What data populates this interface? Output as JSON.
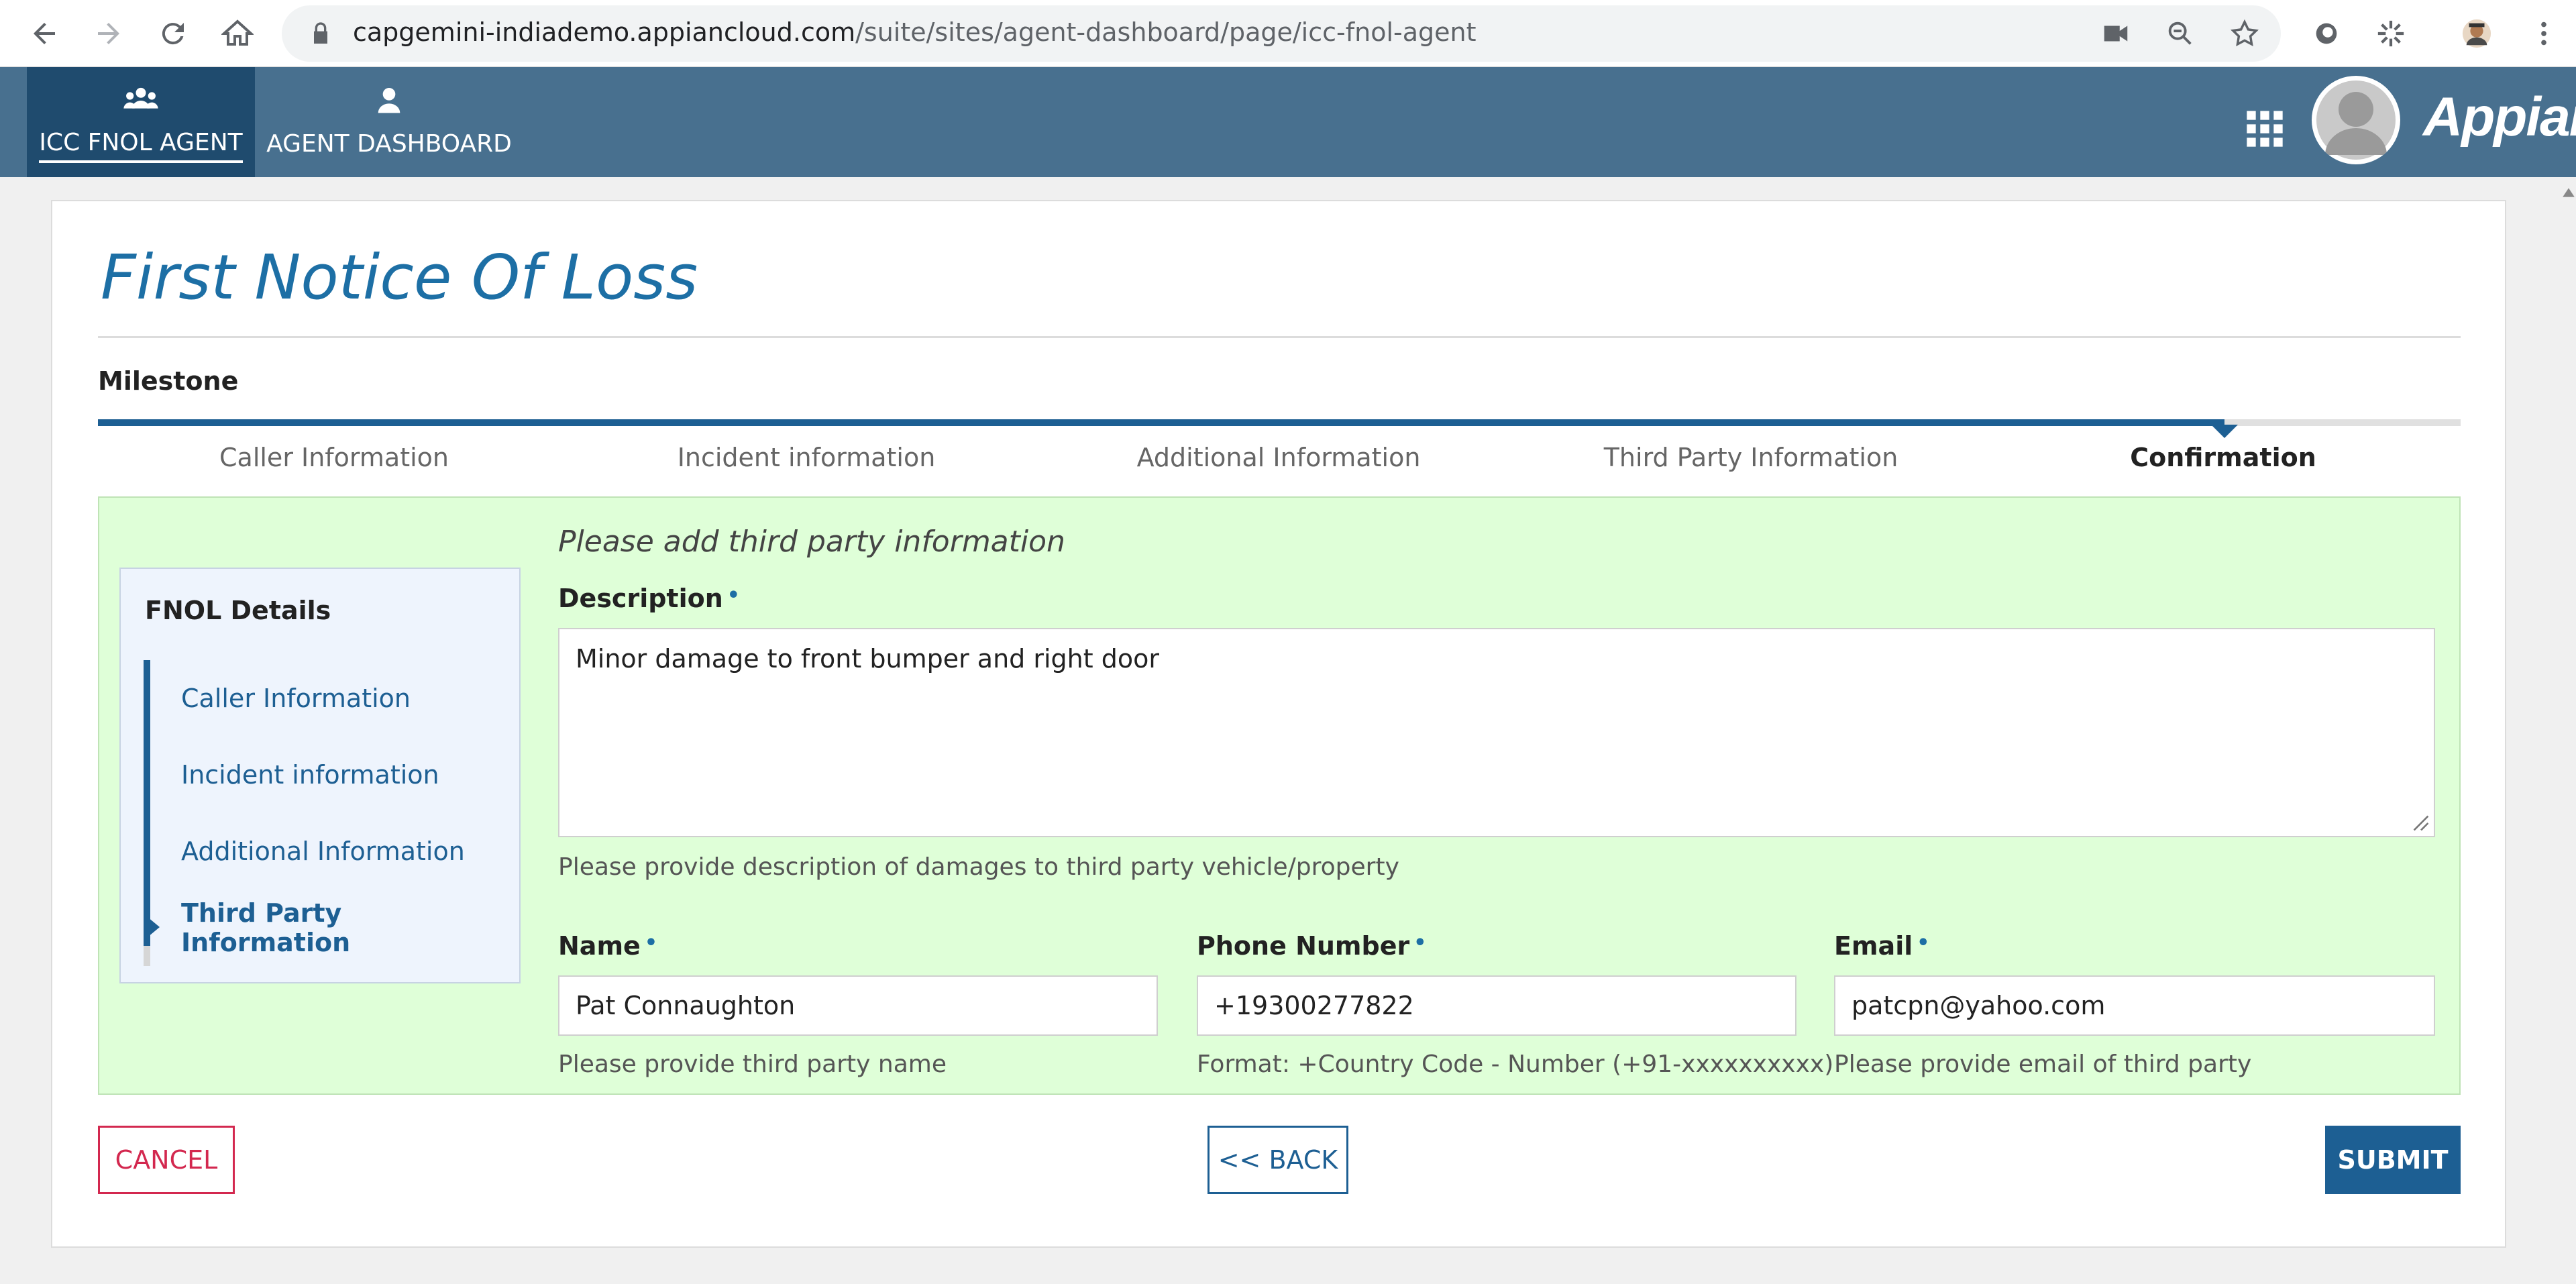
{
  "browser": {
    "url_host": "capgemini-indiademo.appiancloud.com",
    "url_path": "/suite/sites/agent-dashboard/page/icc-fnol-agent"
  },
  "header": {
    "tabs": [
      {
        "label": "ICC FNOL AGENT",
        "icon": "users-icon",
        "active": true
      },
      {
        "label": "AGENT DASHBOARD",
        "icon": "user-icon",
        "active": false
      }
    ],
    "brand": "Appian",
    "colors": {
      "bar": "#48708f",
      "active_tab": "#1f4b6e"
    }
  },
  "page": {
    "title": "First Notice Of Loss",
    "milestone": {
      "label": "Milestone",
      "steps": [
        "Caller Information",
        "Incident information",
        "Additional Information",
        "Third Party Information",
        "Confirmation"
      ],
      "current_index": 4
    }
  },
  "sidebar": {
    "title": "FNOL Details",
    "items": [
      {
        "label": "Caller Information"
      },
      {
        "label": "Incident information"
      },
      {
        "label": "Additional Information"
      },
      {
        "label": "Third Party Information",
        "current": true
      }
    ]
  },
  "form": {
    "section_hint": "Please add third party information",
    "description": {
      "label": "Description",
      "required_mark": "•",
      "value": "Minor damage to front bumper and right door",
      "help": "Please provide description of damages to third party vehicle/property"
    },
    "name": {
      "label": "Name",
      "required_mark": "•",
      "value": "Pat Connaughton",
      "help": "Please provide third party name"
    },
    "phone": {
      "label": "Phone Number",
      "required_mark": "•",
      "value": "+19300277822",
      "help": "Format: +Country Code - Number (+91-xxxxxxxxxx)"
    },
    "email": {
      "label": "Email",
      "required_mark": "•",
      "value": "patcpn@yahoo.com",
      "help": "Please provide email of third party"
    }
  },
  "actions": {
    "cancel": "CANCEL",
    "back": "<< BACK",
    "submit": "SUBMIT",
    "colors": {
      "cancel": "#d3284f",
      "primary": "#1d5f93"
    }
  }
}
